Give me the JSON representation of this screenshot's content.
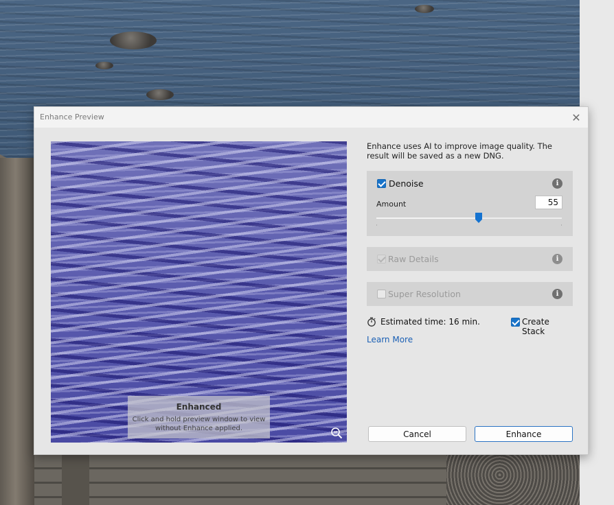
{
  "dialog": {
    "title": "Enhance Preview",
    "close_glyph": "✕"
  },
  "preview": {
    "overlay_title": "Enhanced",
    "overlay_hint": "Click and hold preview window to view without Enhance applied.",
    "zoom_icon": "zoom-out-icon"
  },
  "panel": {
    "description": "Enhance uses AI to improve image quality. The result will be saved as a new DNG.",
    "denoise": {
      "label": "Denoise",
      "checked": true,
      "amount_label": "Amount",
      "amount_value": "55",
      "slider_fraction": 0.55
    },
    "raw_details": {
      "label": "Raw Details",
      "checked": true,
      "disabled": true
    },
    "super_resolution": {
      "label": "Super Resolution",
      "checked": false,
      "disabled": true
    },
    "estimated_time": "Estimated time: 16 min.",
    "create_stack": {
      "label": "Create Stack",
      "checked": true
    },
    "learn_more": "Learn More"
  },
  "buttons": {
    "cancel": "Cancel",
    "enhance": "Enhance"
  },
  "colors": {
    "accent": "#1873c9",
    "link": "#1a5fb4"
  }
}
